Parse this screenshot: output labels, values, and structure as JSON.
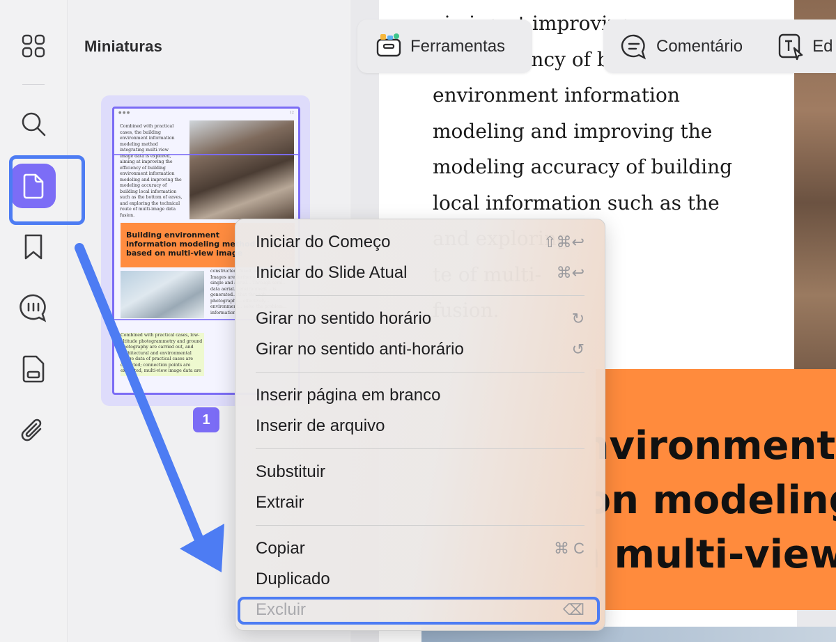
{
  "sidebar": {
    "icons": [
      "apps-grid-icon",
      "search-icon",
      "pages-icon",
      "bookmark-icon",
      "comment-icon",
      "form-icon",
      "attachment-icon"
    ],
    "active": "pages-icon"
  },
  "thumbnails": {
    "title": "Miniaturas",
    "page_number": "1",
    "page_header_number": "12",
    "col_text": "Combined with practical cases, the building environment information modeling method integrating multi-view image data is explored, aiming at improving the efficiency of building environment information modeling and improving the modeling accuracy of building local information such as the bottom of eaves, and exploring the technical route of multi-image data fusion.",
    "orange_title_lines": [
      "Building environment",
      "information modeling method",
      "based on multi-view image"
    ],
    "lower_left_text": "Combined with practical cases, low-altitude photogrammetry and ground photography are carried out, and architectural and environmental image data of practical cases are collected; connection points are extracted, multi-view image data are",
    "lower_right_text": "constructed, fused, and generated. Images are further supplemented by single and aerial... Through semi... data aerial... environment... is generated... that through... photography... effectively... environment... solve the problem... information"
  },
  "toolbar": {
    "tools_label": "Ferramentas",
    "comment_label": "Comentário",
    "edit_label": "Ed"
  },
  "document": {
    "body_lines": [
      "                    aiming at improving",
      "the efficiency of building",
      "environment information",
      "modeling and improving the",
      "modeling accuracy of building",
      "local information such as the",
      "                    and exploring",
      "                    te of multi-",
      "                    fusion."
    ],
    "title_lines": [
      "Building environment",
      "information modeling",
      "based on multi-view"
    ]
  },
  "context_menu": {
    "items": [
      {
        "label": "Iniciar do Começo",
        "shortcut": "⇧⌘↩"
      },
      {
        "label": "Iniciar do Slide Atual",
        "shortcut": "⌘↩"
      },
      {
        "label": "Girar no sentido horário",
        "shortcut": "↻"
      },
      {
        "label": "Girar no sentido anti-horário",
        "shortcut": "↺"
      },
      {
        "label": "Inserir página em branco",
        "shortcut": ""
      },
      {
        "label": "Inserir de arquivo",
        "shortcut": ""
      },
      {
        "label": "Substituir",
        "shortcut": ""
      },
      {
        "label": "Extrair",
        "shortcut": ""
      },
      {
        "label": "Copiar",
        "shortcut": "⌘ C"
      },
      {
        "label": "Duplicado",
        "shortcut": ""
      },
      {
        "label": "Excluir",
        "shortcut": "⌫"
      }
    ]
  },
  "colors": {
    "accent": "#7b6cf5",
    "annotation_blue": "#4d7cf3",
    "orange": "#ff8b3d"
  }
}
